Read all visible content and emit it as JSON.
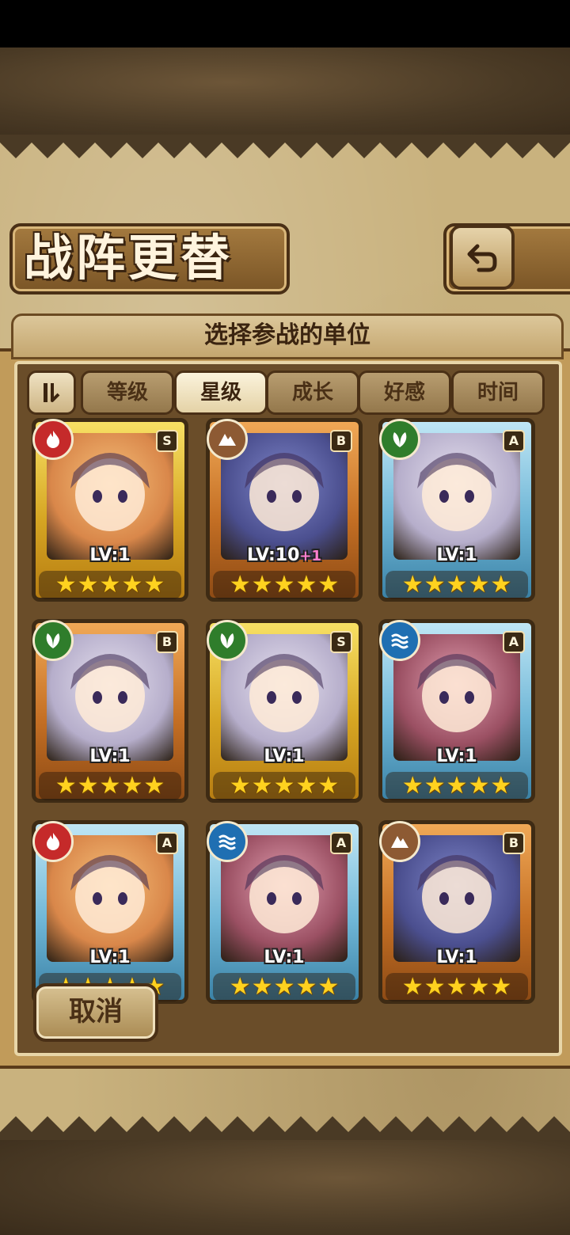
{
  "header": {
    "title": "战阵更替",
    "back_icon": "return-arrow-icon"
  },
  "panel": {
    "subtitle": "选择参战的单位"
  },
  "sort": {
    "toggle_icon": "sort-order-icon",
    "tabs": [
      {
        "label": "等级",
        "active": false
      },
      {
        "label": "星级",
        "active": true
      },
      {
        "label": "成长",
        "active": false
      },
      {
        "label": "好感",
        "active": false
      },
      {
        "label": "时间",
        "active": false
      }
    ]
  },
  "units": [
    {
      "element": "fire",
      "rank": "S",
      "frame": "gold",
      "level": "LV:1",
      "bonus": "",
      "stars": 5
    },
    {
      "element": "earth",
      "rank": "B",
      "frame": "bronze",
      "level": "LV:10",
      "bonus": "+1",
      "stars": 5
    },
    {
      "element": "grass",
      "rank": "A",
      "frame": "blue",
      "level": "LV:1",
      "bonus": "",
      "stars": 5
    },
    {
      "element": "grass",
      "rank": "B",
      "frame": "bronze",
      "level": "LV:1",
      "bonus": "",
      "stars": 5
    },
    {
      "element": "grass",
      "rank": "S",
      "frame": "gold",
      "level": "LV:1",
      "bonus": "",
      "stars": 5
    },
    {
      "element": "water",
      "rank": "A",
      "frame": "blue",
      "level": "LV:1",
      "bonus": "",
      "stars": 5
    },
    {
      "element": "fire",
      "rank": "A",
      "frame": "blue",
      "level": "LV:1",
      "bonus": "",
      "stars": 5
    },
    {
      "element": "water",
      "rank": "A",
      "frame": "blue",
      "level": "LV:1",
      "bonus": "",
      "stars": 5
    },
    {
      "element": "earth",
      "rank": "B",
      "frame": "bronze",
      "level": "LV:1",
      "bonus": "",
      "stars": 5
    }
  ],
  "footer": {
    "cancel_label": "取消"
  }
}
